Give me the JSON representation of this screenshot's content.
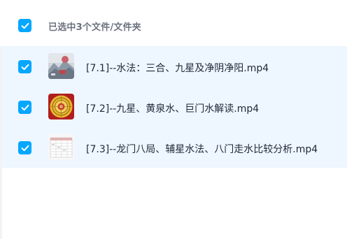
{
  "header": {
    "selection_label": "已选中3个文件/文件夹"
  },
  "files": [
    {
      "name": "[7.1]--水法：三合、九星及净阴净阳.mp4",
      "selected": true,
      "thumbnail": "landscape-video-thumbnail"
    },
    {
      "name": "[7.2]--九星、黄泉水、巨门水解读.mp4",
      "selected": true,
      "thumbnail": "compass-video-thumbnail"
    },
    {
      "name": "[7.3]--龙门八局、辅星水法、八门走水比较分析.mp4",
      "selected": true,
      "thumbnail": "table-video-thumbnail"
    }
  ],
  "colors": {
    "accent": "#06a7ff",
    "selected_row_bg": "#eef6ff"
  }
}
